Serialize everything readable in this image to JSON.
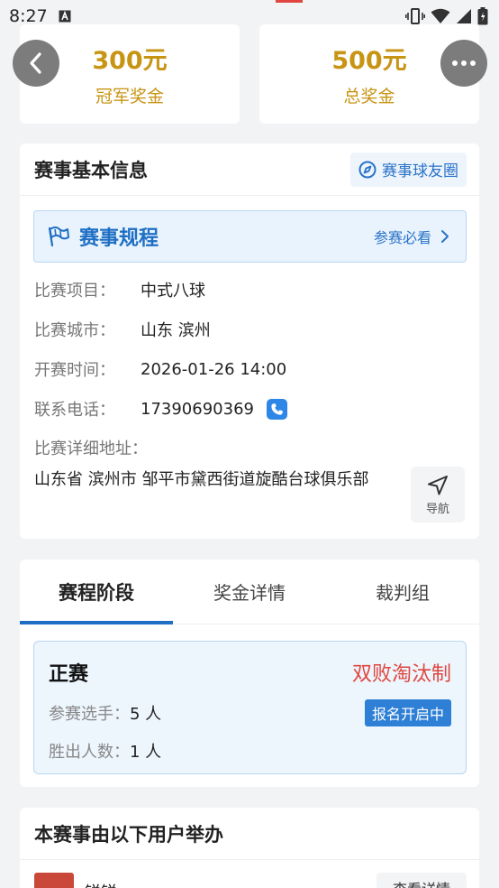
{
  "status_bar": {
    "time": "8:27"
  },
  "prizes": [
    {
      "amount": "300元",
      "label": "冠军奖金"
    },
    {
      "amount": "500元",
      "label": "总奖金"
    }
  ],
  "info": {
    "title": "赛事基本信息",
    "circle_link": "赛事球友圈",
    "rules": {
      "title": "赛事规程",
      "hint": "参赛必看"
    },
    "rows": [
      {
        "label": "比赛项目：",
        "value": "中式八球"
      },
      {
        "label": "比赛城市：",
        "value": "山东 滨州"
      },
      {
        "label": "开赛时间：",
        "value": "2026-01-26 14:00"
      },
      {
        "label": "联系电话：",
        "value": "17390690369"
      }
    ],
    "address_label": "比赛详细地址：",
    "address": "山东省 滨州市 邹平市黛西街道旋酷台球俱乐部",
    "nav_label": "导航"
  },
  "tabs": [
    "赛程阶段",
    "奖金详情",
    "裁判组"
  ],
  "stage": {
    "name": "正赛",
    "format": "双败淘汰制",
    "players_label": "参赛选手：",
    "players_value": "5 人",
    "winners_label": "胜出人数：",
    "winners_value": "1 人",
    "badge": "报名开启中"
  },
  "organizer": {
    "title": "本赛事由以下用户举办",
    "name": "锐锐",
    "button": "查看详情"
  },
  "colors": {
    "gold": "#c89414",
    "blue": "#1e6fc4",
    "red": "#e0463f"
  }
}
